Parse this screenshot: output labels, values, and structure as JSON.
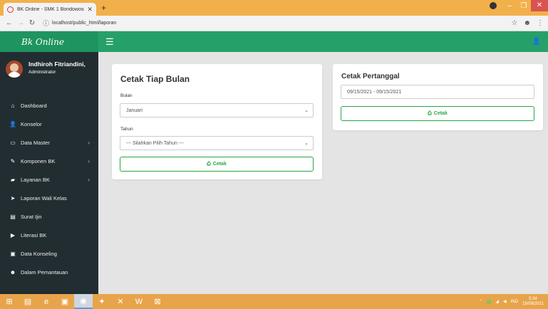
{
  "browser": {
    "tab_title": "BK Online - SMK 1 Bondowoso",
    "url": "localhost/public_html/laporan"
  },
  "app": {
    "brand": "Bk Online"
  },
  "user": {
    "name": "Indhiroh Fitriandini,",
    "role": "Administrator"
  },
  "sidebar": {
    "items": [
      {
        "label": "Dashboard",
        "icon": "home-icon",
        "glyph": "⌂",
        "has_arrow": false
      },
      {
        "label": "Konselor",
        "icon": "user-icon",
        "glyph": "👤",
        "has_arrow": false
      },
      {
        "label": "Data Master",
        "icon": "monitor-icon",
        "glyph": "▭",
        "has_arrow": true
      },
      {
        "label": "Komponen BK",
        "icon": "edit-icon",
        "glyph": "✎",
        "has_arrow": true
      },
      {
        "label": "Layanan BK",
        "icon": "book-icon",
        "glyph": "▰",
        "has_arrow": true
      },
      {
        "label": "Laporan Wali Kelas",
        "icon": "send-icon",
        "glyph": "➤",
        "has_arrow": false
      },
      {
        "label": "Surat Ijin",
        "icon": "file-icon",
        "glyph": "▤",
        "has_arrow": false
      },
      {
        "label": "Literasi BK",
        "icon": "video-icon",
        "glyph": "▶",
        "has_arrow": false
      },
      {
        "label": "Data Konseling",
        "icon": "briefcase-icon",
        "glyph": "▣",
        "has_arrow": false
      },
      {
        "label": "Dalam Pemantauan",
        "icon": "users-icon",
        "glyph": "☻",
        "has_arrow": false
      }
    ]
  },
  "monthly": {
    "title": "Cetak Tiap Bulan",
    "bulan_label": "Bulan",
    "bulan_value": "Januari",
    "tahun_label": "Tahun",
    "tahun_placeholder": "--- Silahkan Pilih Tahun ---",
    "button": "Cetak"
  },
  "daterange": {
    "title": "Cetak Pertanggal",
    "value": "09/15/2021 - 09/15/2021",
    "button": "Cetak"
  },
  "taskbar": {
    "lang": "IND",
    "time": "5:34",
    "date": "15/09/2021"
  },
  "colors": {
    "header": "#26a069",
    "sidebar": "#222d32",
    "button_outline": "#28a745",
    "titlebar": "#f2b04a"
  }
}
